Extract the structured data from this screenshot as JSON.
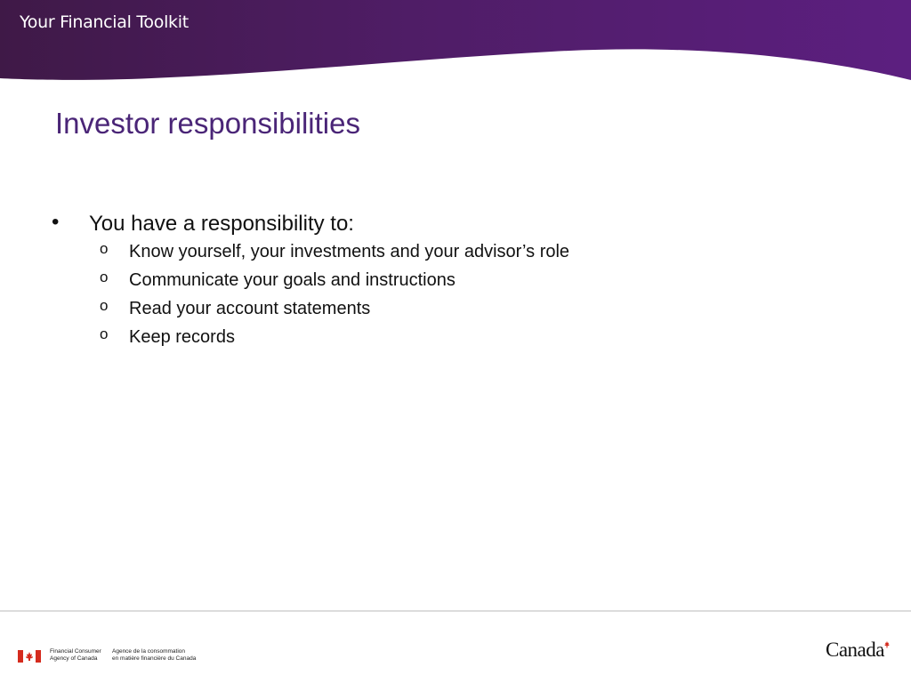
{
  "header": {
    "toolkit_title": "Your Financial Toolkit"
  },
  "slide": {
    "title": "Investor responsibilities",
    "bullet": {
      "marker": "•",
      "text": "You have a responsibility to:"
    },
    "sub_marker": "o",
    "sub_items": [
      "Know yourself, your investments and your advisor’s role",
      "Communicate your goals and instructions",
      "Read your account statements",
      "Keep records"
    ]
  },
  "footer": {
    "agency_en_line1": "Financial Consumer",
    "agency_en_line2": "Agency of Canada",
    "agency_fr_line1": "Agence de la consommation",
    "agency_fr_line2": "en matière financière du Canada",
    "wordmark": "Canada"
  },
  "colors": {
    "header_purple": "#5a1f7a",
    "title_purple": "#4a2577",
    "canada_red": "#d52b1e"
  }
}
